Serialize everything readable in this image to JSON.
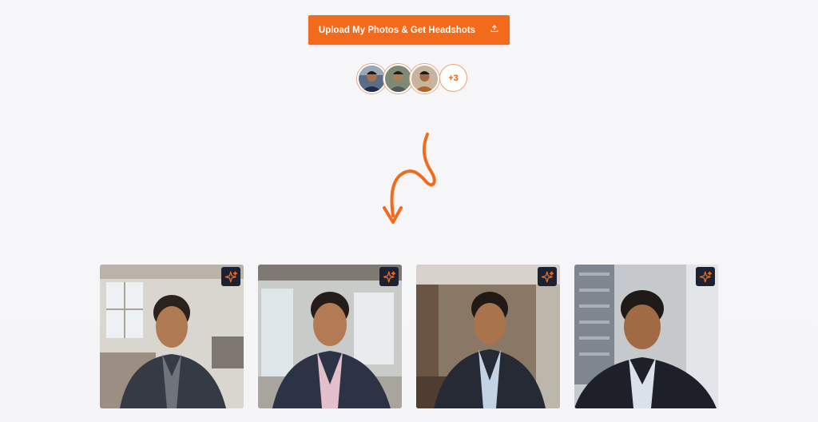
{
  "upload": {
    "label": "Upload My Photos & Get Headshots",
    "icon": "upload-icon"
  },
  "avatars": {
    "count_label": "+3"
  },
  "headshots": [
    {
      "icon": "sparkle-icon"
    },
    {
      "icon": "sparkle-icon"
    },
    {
      "icon": "sparkle-icon"
    },
    {
      "icon": "sparkle-icon"
    }
  ],
  "colors": {
    "accent": "#f26a1b",
    "badge_bg": "#1d2233",
    "background": "#f6f6f8"
  }
}
